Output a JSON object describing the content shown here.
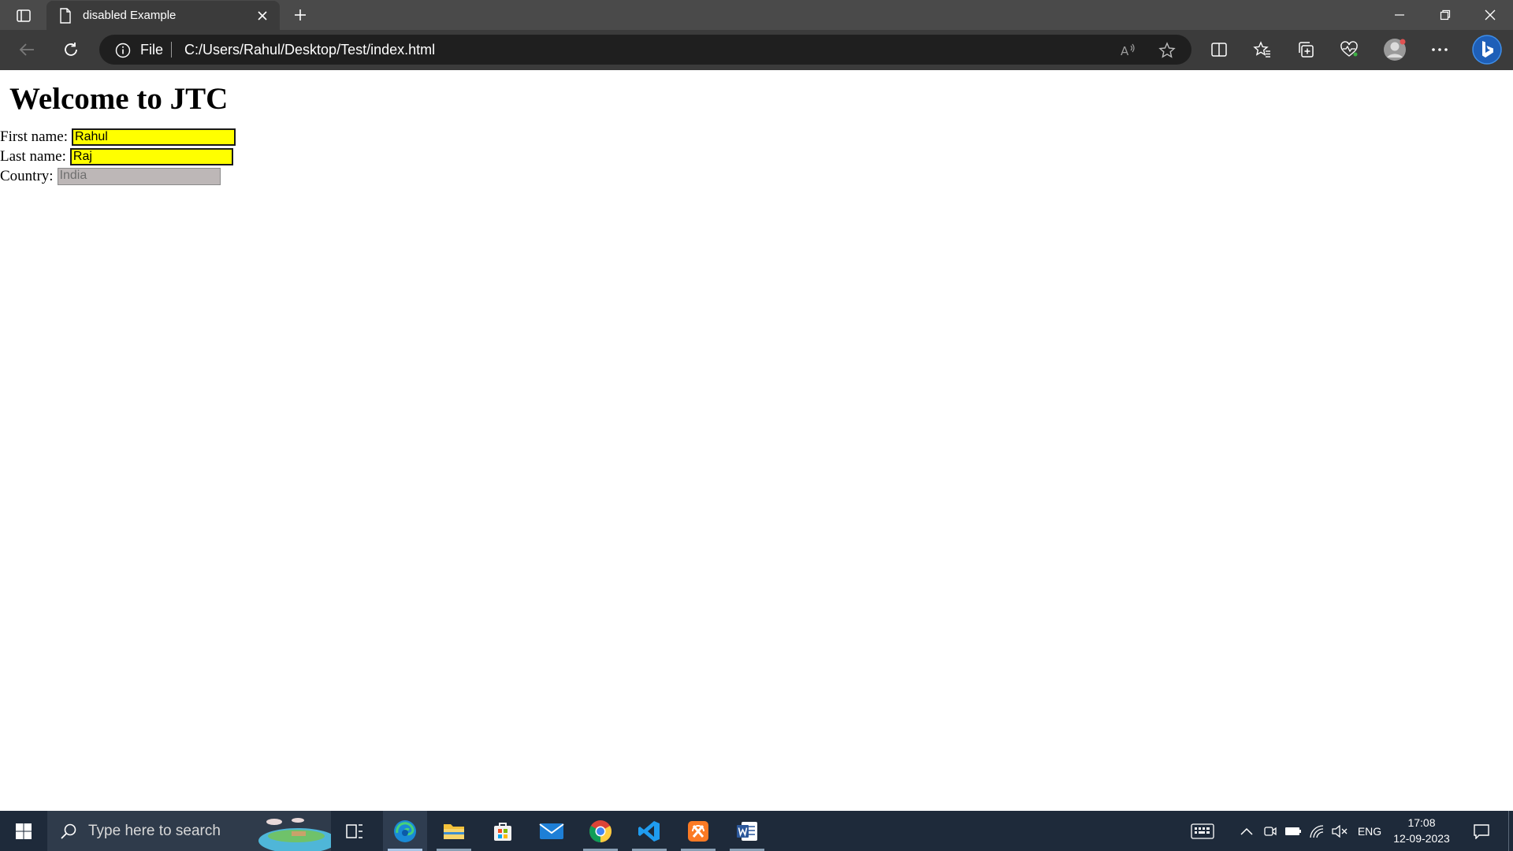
{
  "browser": {
    "tab_title": "disabled Example",
    "address_scheme": "File",
    "address_url": "C:/Users/Rahul/Desktop/Test/index.html"
  },
  "page": {
    "heading": "Welcome to JTC",
    "first_name_label": "First name:",
    "first_name_value": "Rahul",
    "last_name_label": "Last name:",
    "last_name_value": "Raj",
    "country_label": "Country:",
    "country_value": "India"
  },
  "taskbar": {
    "search_placeholder": "Type here to search",
    "language": "ENG",
    "time": "17:08",
    "date": "12-09-2023"
  },
  "colors": {
    "active_field_bg": "#ffff00",
    "disabled_field_bg": "#bdb7b7",
    "titlebar": "#4a4a4a",
    "toolbar": "#3b3b3b",
    "taskbar": "#1e2a3a"
  }
}
